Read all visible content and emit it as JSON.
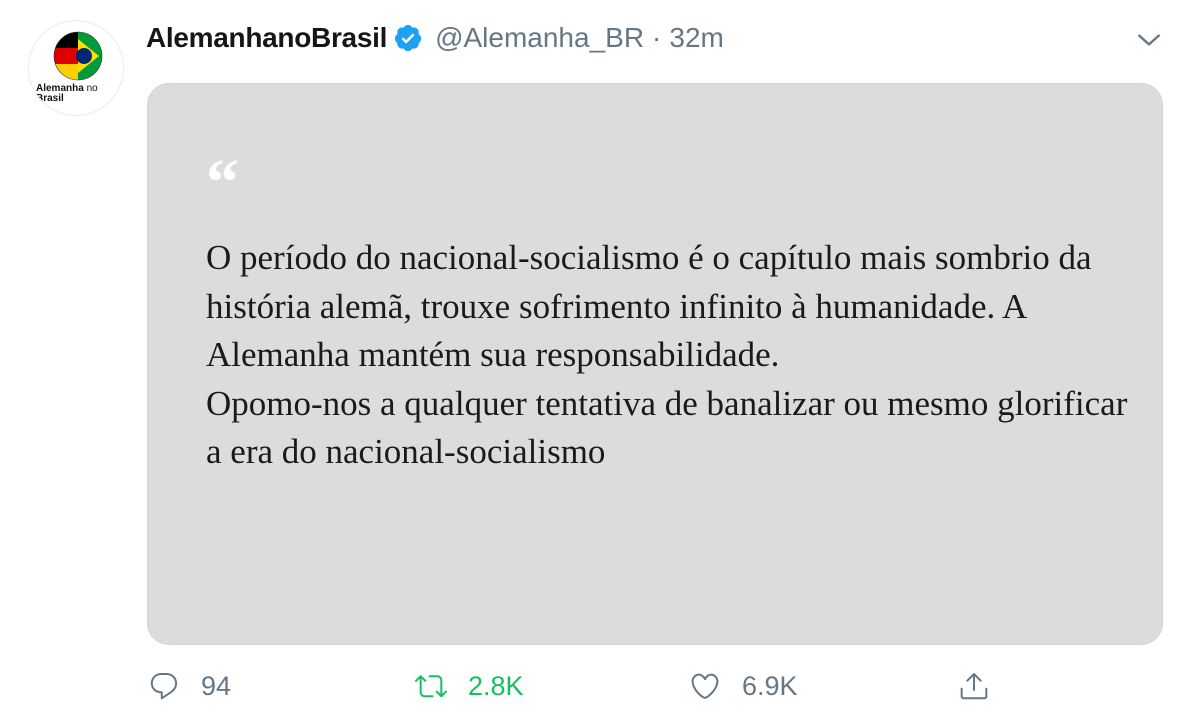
{
  "tweet": {
    "avatar": {
      "logo_text_bold": "Alemanha",
      "logo_text_light": " no",
      "logo_text_line2": "Brasil"
    },
    "author": {
      "display_name": "AlemanhanoBrasil",
      "handle": "@Alemanha_BR",
      "separator": "·",
      "time": "32m",
      "verified": true
    },
    "card": {
      "quote_mark": "“",
      "paragraphs": [
        "O período do nacional-socialismo é o capítulo mais sombrio da história alemã, trouxe sofrimento infinito à humanidade. A Alemanha mantém sua responsabilidade.",
        "Opomo-nos a qualquer tentativa de banalizar ou mesmo glorificar a era do nacional-socialismo"
      ]
    },
    "actions": {
      "reply_count": "94",
      "retweet_count": "2.8K",
      "like_count": "6.9K"
    }
  },
  "icons": [
    "verified-badge-icon",
    "chevron-down-icon",
    "reply-icon",
    "retweet-icon",
    "like-icon",
    "share-icon"
  ],
  "colors": {
    "verified": "#1da1f2",
    "retweet": "#17bf63",
    "muted": "#657786",
    "card_bg": "#dcdcdc"
  }
}
